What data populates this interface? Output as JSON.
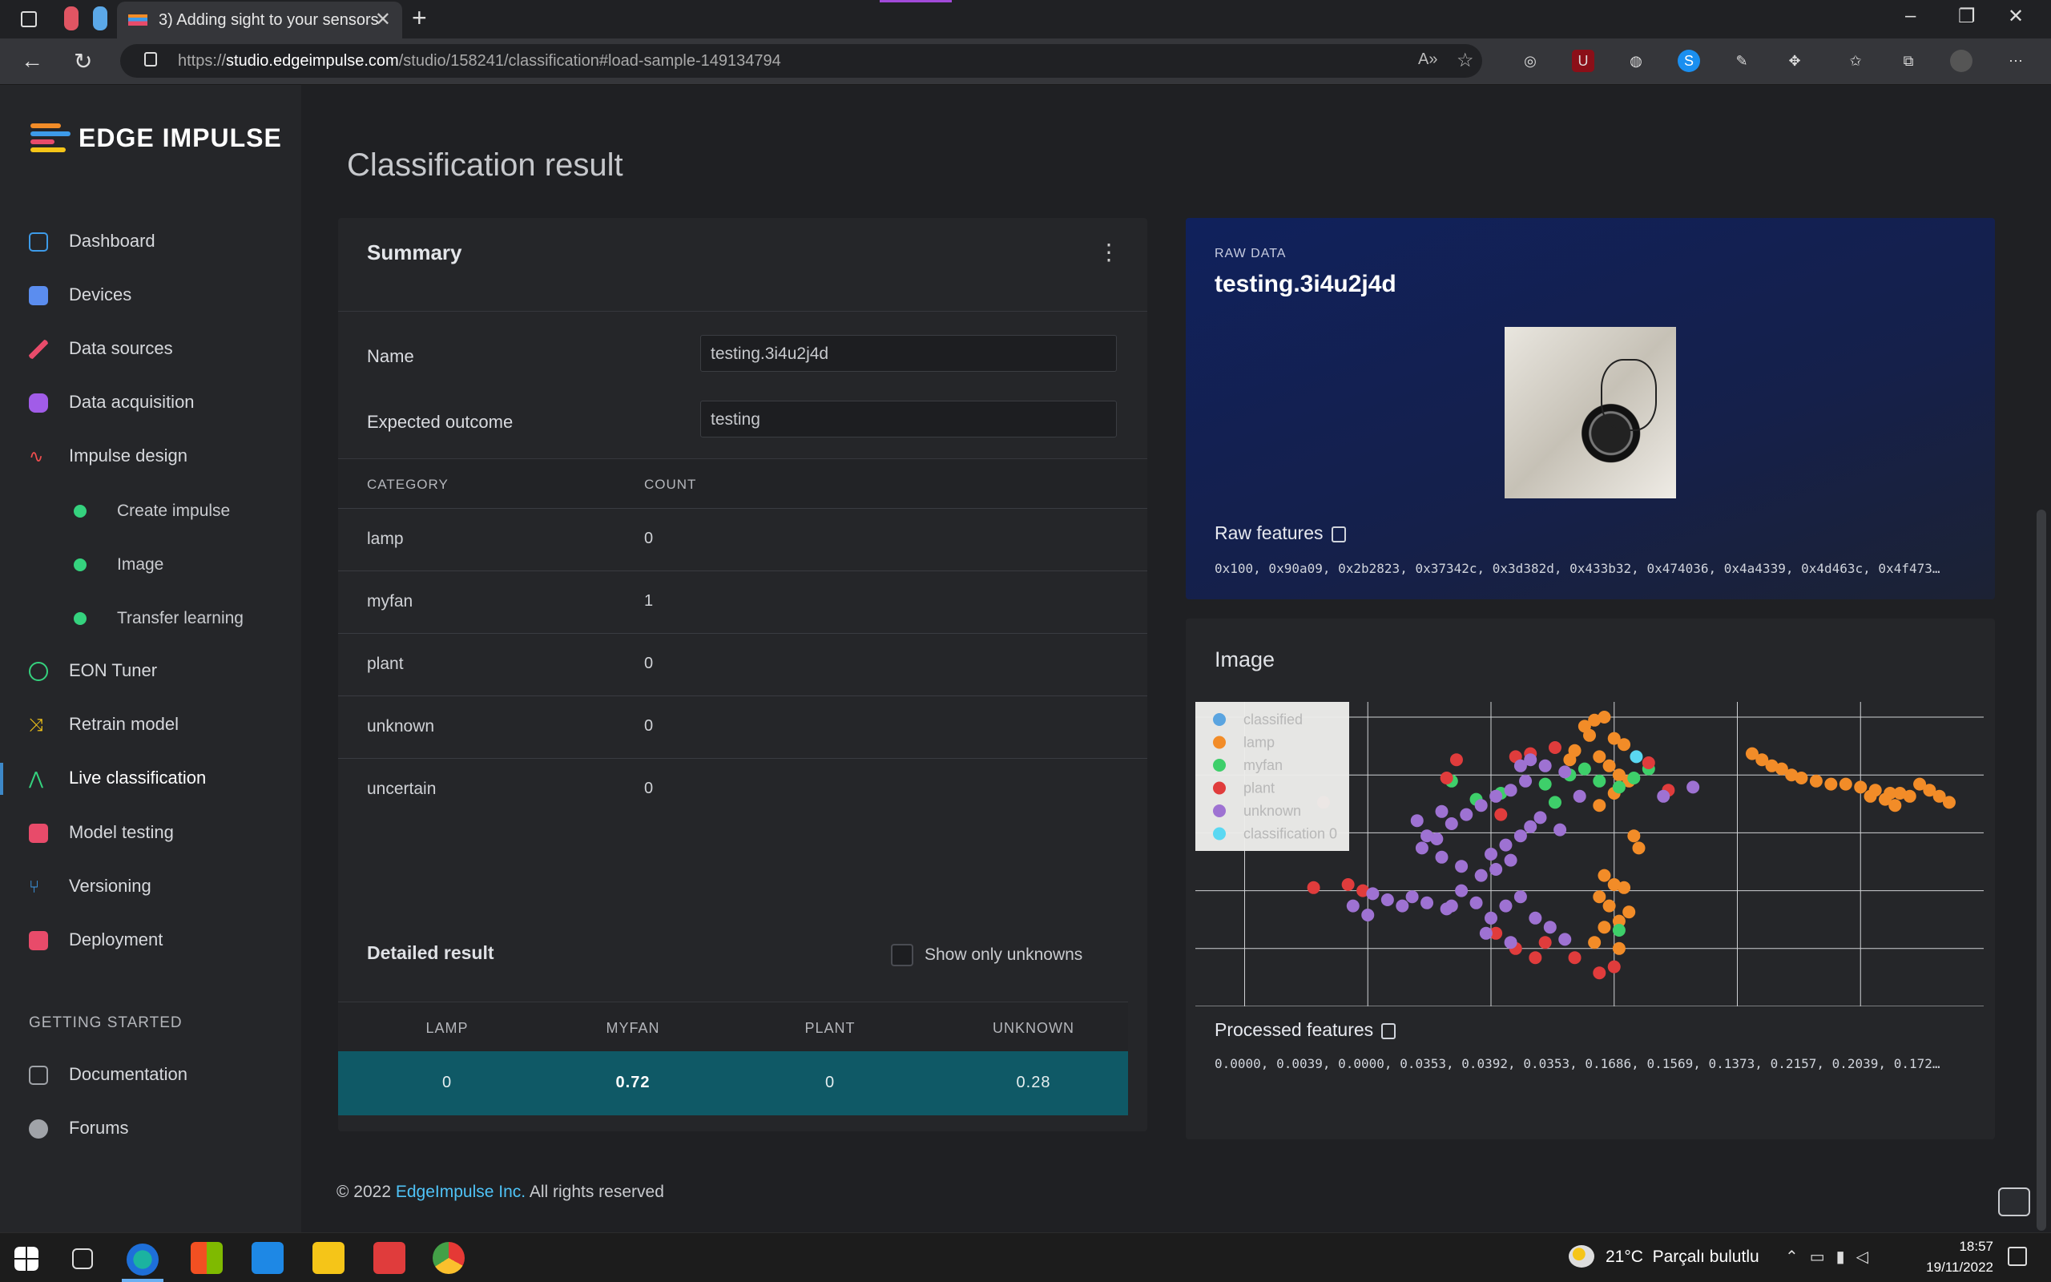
{
  "browser": {
    "tab_title": "3) Adding sight to your sensors",
    "url_prefix": "https://",
    "url_host": "studio.edgeimpulse.com",
    "url_path": "/studio/158241/classification#load-sample-149134794"
  },
  "brand": {
    "name": "EDGE IMPULSE"
  },
  "sidebar": {
    "items": [
      {
        "label": "Dashboard",
        "icon": "monitor-icon",
        "color": "#3d9be9"
      },
      {
        "label": "Devices",
        "icon": "chip-icon",
        "color": "#5b8def"
      },
      {
        "label": "Data sources",
        "icon": "wand-icon",
        "color": "#e84b6a"
      },
      {
        "label": "Data acquisition",
        "icon": "database-icon",
        "color": "#a15ce8"
      },
      {
        "label": "Impulse design",
        "icon": "pulse-icon",
        "color": "#f04e4e"
      },
      {
        "label": "EON Tuner",
        "icon": "compass-icon",
        "color": "#35d27e"
      },
      {
        "label": "Retrain model",
        "icon": "shuffle-icon",
        "color": "#f5c518"
      },
      {
        "label": "Live classification",
        "icon": "branch-icon",
        "color": "#35d27e"
      },
      {
        "label": "Model testing",
        "icon": "clipboard-icon",
        "color": "#e84b6a"
      },
      {
        "label": "Versioning",
        "icon": "git-icon",
        "color": "#3d9be9"
      },
      {
        "label": "Deployment",
        "icon": "box-icon",
        "color": "#e84b6a"
      }
    ],
    "sub_items": [
      "Create impulse",
      "Image",
      "Transfer learning"
    ],
    "section": "GETTING STARTED",
    "bottom_items": [
      {
        "label": "Documentation",
        "icon": "book-icon"
      },
      {
        "label": "Forums",
        "icon": "chat-icon"
      }
    ]
  },
  "page": {
    "title": "Classification result"
  },
  "summary": {
    "title": "Summary",
    "name_label": "Name",
    "name_value": "testing.3i4u2j4d",
    "expected_label": "Expected outcome",
    "expected_value": "testing",
    "col_category": "CATEGORY",
    "col_count": "COUNT",
    "rows": [
      {
        "category": "lamp",
        "count": "0"
      },
      {
        "category": "myfan",
        "count": "1"
      },
      {
        "category": "plant",
        "count": "0"
      },
      {
        "category": "unknown",
        "count": "0"
      },
      {
        "category": "uncertain",
        "count": "0"
      }
    ],
    "detailed_title": "Detailed result",
    "show_unknowns_label": "Show only unknowns",
    "detail_headers": [
      "LAMP",
      "MYFAN",
      "PLANT",
      "UNKNOWN"
    ],
    "detail_values": [
      "0",
      "0.72",
      "0",
      "0.28"
    ]
  },
  "raw": {
    "kicker": "RAW DATA",
    "title": "testing.3i4u2j4d",
    "features_label": "Raw features",
    "features_text": "0x100, 0x90a09, 0x2b2823, 0x37342c, 0x3d382d, 0x433b32, 0x474036, 0x4a4339, 0x4d463c, 0x4f473…"
  },
  "image_panel": {
    "title": "Image",
    "processed_label": "Processed features",
    "processed_text": "0.0000, 0.0039, 0.0000, 0.0353, 0.0392, 0.0353, 0.1686, 0.1569, 0.1373, 0.2157, 0.2039, 0.172…"
  },
  "chart_data": {
    "type": "scatter",
    "title": "",
    "xlabel": "",
    "ylabel": "",
    "grid": true,
    "legend": "top-left",
    "series": [
      {
        "name": "classified",
        "color": "#5aa4e0",
        "points": []
      },
      {
        "name": "lamp",
        "color": "#f28c28",
        "points": [
          [
            7.9,
            9.2
          ],
          [
            8.1,
            9.4
          ],
          [
            8.3,
            9.5
          ],
          [
            8.0,
            8.9
          ],
          [
            8.5,
            8.8
          ],
          [
            8.7,
            8.6
          ],
          [
            7.7,
            8.4
          ],
          [
            7.6,
            8.1
          ],
          [
            8.2,
            8.2
          ],
          [
            8.4,
            7.9
          ],
          [
            8.6,
            7.6
          ],
          [
            8.8,
            7.4
          ],
          [
            8.5,
            7.0
          ],
          [
            8.2,
            6.6
          ],
          [
            8.9,
            5.6
          ],
          [
            9.0,
            5.2
          ],
          [
            8.3,
            4.3
          ],
          [
            8.5,
            4.0
          ],
          [
            8.7,
            3.9
          ],
          [
            8.2,
            3.6
          ],
          [
            8.4,
            3.3
          ],
          [
            8.8,
            3.1
          ],
          [
            8.6,
            2.8
          ],
          [
            8.3,
            2.6
          ],
          [
            8.1,
            2.1
          ],
          [
            8.6,
            1.9
          ],
          [
            11.3,
            8.3
          ],
          [
            11.5,
            8.1
          ],
          [
            11.7,
            7.9
          ],
          [
            11.9,
            7.8
          ],
          [
            12.1,
            7.6
          ],
          [
            12.3,
            7.5
          ],
          [
            12.6,
            7.4
          ],
          [
            12.9,
            7.3
          ],
          [
            13.2,
            7.3
          ],
          [
            13.5,
            7.2
          ],
          [
            13.8,
            7.1
          ],
          [
            14.1,
            7.0
          ],
          [
            14.3,
            7.0
          ],
          [
            14.5,
            6.9
          ],
          [
            14.7,
            7.3
          ],
          [
            14.9,
            7.1
          ],
          [
            15.1,
            6.9
          ],
          [
            14.2,
            6.6
          ],
          [
            14.0,
            6.8
          ],
          [
            13.7,
            6.9
          ],
          [
            15.3,
            6.7
          ]
        ]
      },
      {
        "name": "myfan",
        "color": "#3ecf6a",
        "points": [
          [
            5.2,
            7.4
          ],
          [
            5.7,
            6.8
          ],
          [
            6.2,
            7.0
          ],
          [
            7.1,
            7.3
          ],
          [
            7.6,
            7.6
          ],
          [
            7.9,
            7.8
          ],
          [
            8.2,
            7.4
          ],
          [
            8.6,
            7.2
          ],
          [
            8.9,
            7.5
          ],
          [
            9.2,
            7.8
          ],
          [
            7.3,
            6.7
          ],
          [
            8.6,
            2.5
          ]
        ]
      },
      {
        "name": "plant",
        "color": "#e03c3c",
        "points": [
          [
            2.6,
            6.7
          ],
          [
            3.1,
            4.0
          ],
          [
            3.4,
            3.8
          ],
          [
            5.3,
            8.1
          ],
          [
            5.1,
            7.5
          ],
          [
            6.5,
            8.2
          ],
          [
            7.3,
            8.5
          ],
          [
            6.8,
            8.3
          ],
          [
            9.2,
            8.0
          ],
          [
            9.6,
            7.1
          ],
          [
            6.2,
            6.3
          ],
          [
            6.1,
            2.4
          ],
          [
            6.5,
            1.9
          ],
          [
            6.9,
            1.6
          ],
          [
            7.1,
            2.1
          ],
          [
            8.5,
            1.3
          ],
          [
            8.2,
            1.1
          ],
          [
            7.7,
            1.6
          ],
          [
            2.4,
            3.9
          ]
        ]
      },
      {
        "name": "unknown",
        "color": "#9e72d2",
        "points": [
          [
            3.6,
            3.7
          ],
          [
            3.9,
            3.5
          ],
          [
            4.2,
            3.3
          ],
          [
            4.4,
            3.6
          ],
          [
            4.7,
            3.4
          ],
          [
            5.1,
            3.2
          ],
          [
            5.4,
            3.8
          ],
          [
            5.7,
            3.4
          ],
          [
            4.6,
            5.2
          ],
          [
            4.9,
            5.5
          ],
          [
            5.2,
            6.0
          ],
          [
            5.5,
            6.3
          ],
          [
            5.8,
            6.6
          ],
          [
            6.1,
            6.9
          ],
          [
            6.4,
            7.1
          ],
          [
            6.7,
            7.4
          ],
          [
            6.0,
            5.0
          ],
          [
            6.3,
            5.3
          ],
          [
            6.6,
            5.6
          ],
          [
            5.8,
            4.3
          ],
          [
            6.1,
            4.5
          ],
          [
            6.4,
            4.8
          ],
          [
            5.4,
            4.6
          ],
          [
            5.0,
            4.9
          ],
          [
            4.7,
            5.6
          ],
          [
            6.0,
            2.9
          ],
          [
            6.3,
            3.3
          ],
          [
            6.6,
            3.6
          ],
          [
            6.9,
            2.9
          ],
          [
            7.2,
            2.6
          ],
          [
            7.5,
            2.2
          ],
          [
            6.4,
            2.1
          ],
          [
            5.9,
            2.4
          ],
          [
            5.2,
            3.3
          ],
          [
            6.8,
            8.1
          ],
          [
            7.1,
            7.9
          ],
          [
            7.5,
            7.7
          ],
          [
            7.8,
            6.9
          ],
          [
            9.5,
            6.9
          ],
          [
            10.1,
            7.2
          ],
          [
            4.5,
            6.1
          ],
          [
            5.0,
            6.4
          ],
          [
            6.6,
            7.9
          ],
          [
            6.8,
            5.9
          ],
          [
            7.0,
            6.2
          ],
          [
            7.4,
            5.8
          ],
          [
            3.2,
            3.3
          ],
          [
            3.5,
            3.0
          ]
        ]
      },
      {
        "name": "classification 0",
        "color": "#5ad8f2",
        "points": [
          [
            8.95,
            8.2
          ]
        ]
      }
    ],
    "xlim": [
      0,
      16
    ],
    "ylim": [
      0,
      10
    ]
  }
}
